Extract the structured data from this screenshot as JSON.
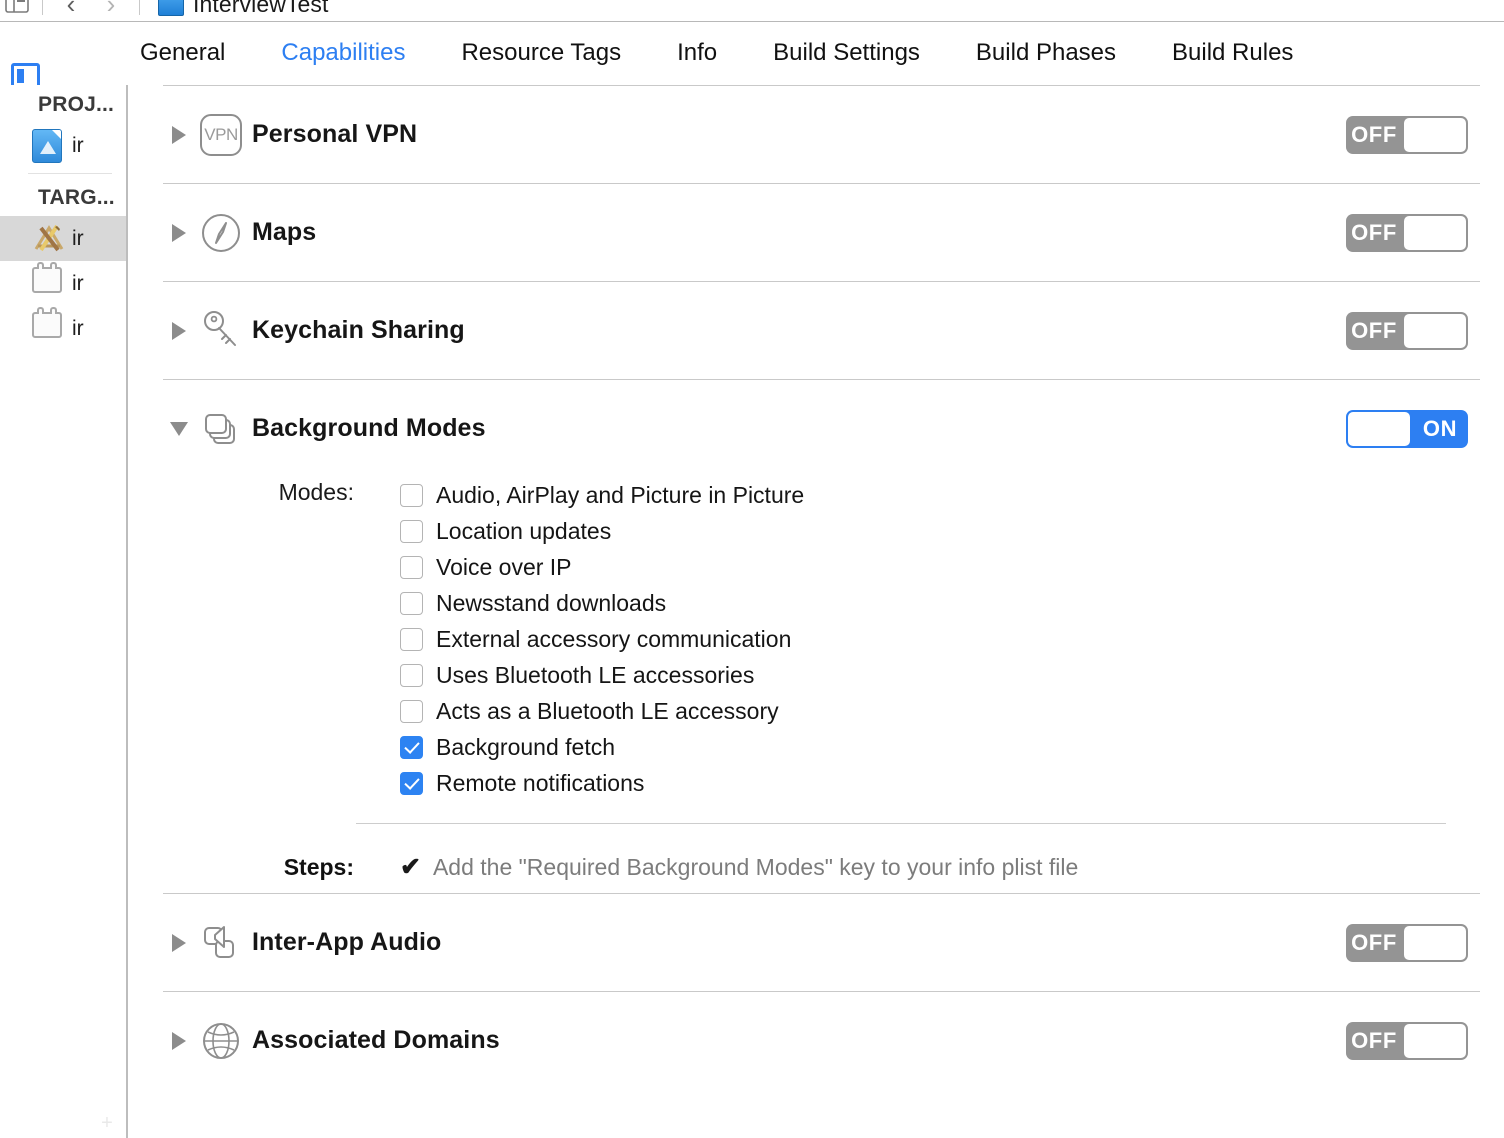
{
  "toolbar": {
    "project_name": "InterviewTest",
    "back_icon": "chevron-left-icon",
    "forward_icon": "chevron-right-icon",
    "editor_icon": "assistant-editor-icon",
    "project_icon": "xcode-project-icon"
  },
  "panel_toggle": {
    "icon": "navigator-panel-toggle-icon"
  },
  "tabs": [
    {
      "label": "General",
      "active": false
    },
    {
      "label": "Capabilities",
      "active": true
    },
    {
      "label": "Resource Tags",
      "active": false
    },
    {
      "label": "Info",
      "active": false
    },
    {
      "label": "Build Settings",
      "active": false
    },
    {
      "label": "Build Phases",
      "active": false
    },
    {
      "label": "Build Rules",
      "active": false
    }
  ],
  "sidebar": {
    "project_header": "PROJ...",
    "targets_header": "TARG...",
    "project_items": [
      {
        "label": "ir",
        "icon": "xcode-project-icon",
        "selected": false
      }
    ],
    "target_items": [
      {
        "label": "ir",
        "icon": "app-target-icon",
        "selected": true
      },
      {
        "label": "ir",
        "icon": "bundle-target-icon",
        "selected": false
      },
      {
        "label": "ir",
        "icon": "bundle-target-icon",
        "selected": false
      }
    ],
    "add_button": "+"
  },
  "colors": {
    "accent_blue": "#2d7ff2",
    "toggle_off_gray": "#949494",
    "checkbox_blue": "#2d83f2",
    "steps_text_gray": "#7c7c7c"
  },
  "capabilities": [
    {
      "title": "Personal VPN",
      "icon": "vpn-icon",
      "expanded": false,
      "disclosure": "triangle-right-icon",
      "toggle": {
        "state": "OFF",
        "on": false
      }
    },
    {
      "title": "Maps",
      "icon": "maps-compass-icon",
      "expanded": false,
      "disclosure": "triangle-right-icon",
      "toggle": {
        "state": "OFF",
        "on": false
      }
    },
    {
      "title": "Keychain Sharing",
      "icon": "key-icon",
      "expanded": false,
      "disclosure": "triangle-right-icon",
      "toggle": {
        "state": "OFF",
        "on": false
      }
    },
    {
      "title": "Background Modes",
      "icon": "background-modes-icon",
      "expanded": true,
      "disclosure": "triangle-down-icon",
      "toggle": {
        "state": "ON",
        "on": true
      }
    },
    {
      "title": "Inter-App Audio",
      "icon": "inter-app-audio-icon",
      "expanded": false,
      "disclosure": "triangle-right-icon",
      "toggle": {
        "state": "OFF",
        "on": false
      }
    },
    {
      "title": "Associated Domains",
      "icon": "globe-icon",
      "expanded": false,
      "disclosure": "triangle-right-icon",
      "toggle": {
        "state": "OFF",
        "on": false
      }
    }
  ],
  "background_modes": {
    "modes_label": "Modes:",
    "modes": [
      {
        "label": "Audio, AirPlay and Picture in Picture",
        "checked": false
      },
      {
        "label": "Location updates",
        "checked": false
      },
      {
        "label": "Voice over IP",
        "checked": false
      },
      {
        "label": "Newsstand downloads",
        "checked": false
      },
      {
        "label": "External accessory communication",
        "checked": false
      },
      {
        "label": "Uses Bluetooth LE accessories",
        "checked": false
      },
      {
        "label": "Acts as a Bluetooth LE accessory",
        "checked": false
      },
      {
        "label": "Background fetch",
        "checked": true
      },
      {
        "label": "Remote notifications",
        "checked": true
      }
    ],
    "steps_label": "Steps:",
    "steps": [
      {
        "check": "✔",
        "text": "Add the \"Required Background Modes\" key to your info plist file"
      }
    ]
  }
}
